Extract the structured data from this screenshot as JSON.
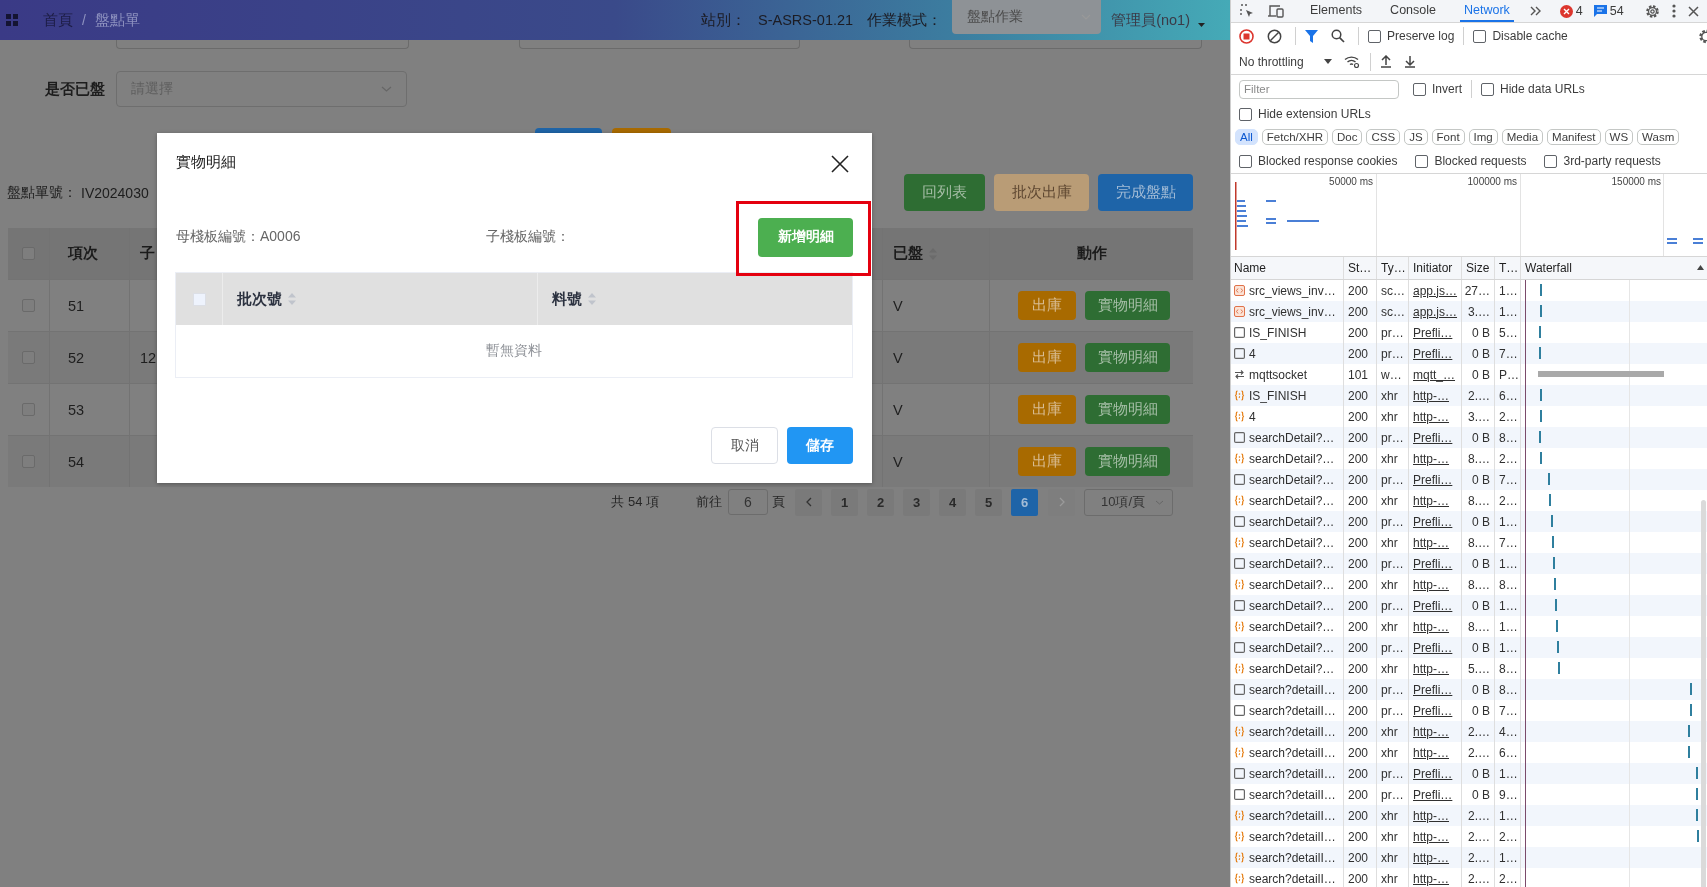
{
  "header": {
    "breadcrumb": [
      {
        "label": "首頁",
        "current": false
      },
      {
        "label": "盤點單",
        "current": true
      }
    ],
    "separator": "/",
    "station_label": "站別：",
    "station": "S-ASRS-01.21",
    "mode_label": "作業模式：",
    "mode": "盤點作業",
    "user": "管理員(no1)"
  },
  "filter": {
    "label": "是否已盤",
    "placeholder": "請選擇"
  },
  "order": {
    "label": "盤點單號：",
    "value": "IV2024030"
  },
  "actions": [
    {
      "label": "回列表",
      "kind": "success",
      "disabled": false
    },
    {
      "label": "批次出庫",
      "kind": "warning",
      "disabled": true
    },
    {
      "label": "完成盤點",
      "kind": "primary",
      "disabled": false
    }
  ],
  "table": {
    "select_all_checked": false,
    "columns": [
      {
        "label": "項次",
        "sortable": false
      },
      {
        "label": "子",
        "sortable": false
      },
      {
        "label": "已盤",
        "sortable": true
      },
      {
        "label": "動作",
        "sortable": false
      }
    ],
    "rows": [
      {
        "checked": false,
        "item": "51",
        "counted": "V",
        "buttons": [
          {
            "label": "出庫",
            "kind": "warning"
          },
          {
            "label": "實物明細",
            "kind": "success"
          }
        ]
      },
      {
        "checked": false,
        "item": "52",
        "column_3": "12",
        "counted": "V",
        "buttons": [
          {
            "label": "出庫",
            "kind": "warning"
          },
          {
            "label": "實物明細",
            "kind": "success"
          }
        ]
      },
      {
        "checked": false,
        "item": "53",
        "counted": "V",
        "buttons": [
          {
            "label": "出庫",
            "kind": "warning"
          },
          {
            "label": "實物明細",
            "kind": "success"
          }
        ]
      },
      {
        "checked": false,
        "item": "54",
        "counted": "V",
        "buttons": [
          {
            "label": "出庫",
            "kind": "warning"
          },
          {
            "label": "實物明細",
            "kind": "success"
          }
        ]
      }
    ]
  },
  "pagination": {
    "total": "共 54 項",
    "goto": "前往",
    "goto_value": "6",
    "page_suffix": "頁",
    "pages": [
      {
        "label": "1",
        "selected": false
      },
      {
        "label": "2",
        "selected": false
      },
      {
        "label": "3",
        "selected": false
      },
      {
        "label": "4",
        "selected": false
      },
      {
        "label": "5",
        "selected": false
      },
      {
        "label": "6",
        "selected": true
      }
    ],
    "next_disabled": true,
    "page_size": "10項/頁"
  },
  "dialog": {
    "title": "實物明細",
    "parent_label": "母棧板編號：",
    "parent_value": "A0006",
    "child_label": "子棧板編號：",
    "add_button": {
      "label": "新增明細",
      "highlighted": true
    },
    "table": {
      "select_all_checked": false,
      "columns": [
        {
          "label": "批次號",
          "sortable": true
        },
        {
          "label": "料號",
          "sortable": true
        }
      ],
      "empty_text": "暫無資料"
    },
    "buttons": [
      {
        "label": "取消",
        "kind": "default"
      },
      {
        "label": "儲存",
        "kind": "primary"
      }
    ]
  },
  "devtools": {
    "tabs": [
      {
        "label": "Elements",
        "selected": false
      },
      {
        "label": "Console",
        "selected": false
      },
      {
        "label": "Network",
        "selected": true
      }
    ],
    "errors": "4",
    "messages": "54",
    "toolbar_checks": [
      {
        "label": "Preserve log",
        "checked": false
      },
      {
        "label": "Disable cache",
        "checked": false
      }
    ],
    "throttling": "No throttling",
    "filter_placeholder": "Filter",
    "filter_checks": [
      {
        "label": "Invert",
        "checked": false
      },
      {
        "label": "Hide data URLs",
        "checked": false
      }
    ],
    "extension_check": {
      "label": "Hide extension URLs",
      "checked": false
    },
    "type_filters": [
      {
        "label": "All",
        "selected": true
      },
      {
        "label": "Fetch/XHR",
        "selected": false
      },
      {
        "label": "Doc",
        "selected": false
      },
      {
        "label": "CSS",
        "selected": false
      },
      {
        "label": "JS",
        "selected": false
      },
      {
        "label": "Font",
        "selected": false
      },
      {
        "label": "Img",
        "selected": false
      },
      {
        "label": "Media",
        "selected": false
      },
      {
        "label": "Manifest",
        "selected": false
      },
      {
        "label": "WS",
        "selected": false
      },
      {
        "label": "Wasm",
        "selected": false
      }
    ],
    "blocked_checks": [
      {
        "label": "Blocked response cookies",
        "checked": false
      },
      {
        "label": "Blocked requests",
        "checked": false
      },
      {
        "label": "3rd-party requests",
        "checked": false
      }
    ],
    "overview_ticks": [
      "50000 ms",
      "100000 ms",
      "150000 ms"
    ],
    "columns": [
      "Name",
      "St…",
      "Ty…",
      "Initiator",
      "Size",
      "T…",
      "Waterfall"
    ],
    "requests": [
      {
        "kind": "script",
        "name": "src_views_inv…",
        "status": "200",
        "type": "sc…",
        "initiator": "app.js…",
        "size": "27…",
        "time": "1…"
      },
      {
        "kind": "script",
        "name": "src_views_inv…",
        "status": "200",
        "type": "sc…",
        "initiator": "app.js…",
        "size": "3.…",
        "time": "1…"
      },
      {
        "kind": "preflight",
        "name": "IS_FINISH",
        "status": "200",
        "type": "pr…",
        "initiator": "Prefli…",
        "size": "0 B",
        "time": "5…"
      },
      {
        "kind": "preflight",
        "name": "4",
        "status": "200",
        "type": "pr…",
        "initiator": "Prefli…",
        "size": "0 B",
        "time": "7…"
      },
      {
        "kind": "websocket",
        "name": "mqttsocket",
        "status": "101",
        "type": "w…",
        "initiator": "mqtt_…",
        "size": "0 B",
        "time": "P…"
      },
      {
        "kind": "xhr",
        "name": "IS_FINISH",
        "status": "200",
        "type": "xhr",
        "initiator": "http-…",
        "size": "2.…",
        "time": "6…"
      },
      {
        "kind": "xhr",
        "name": "4",
        "status": "200",
        "type": "xhr",
        "initiator": "http-…",
        "size": "3.…",
        "time": "2…"
      },
      {
        "kind": "preflight",
        "name": "searchDetail?…",
        "status": "200",
        "type": "pr…",
        "initiator": "Prefli…",
        "size": "0 B",
        "time": "8…"
      },
      {
        "kind": "xhr",
        "name": "searchDetail?…",
        "status": "200",
        "type": "xhr",
        "initiator": "http-…",
        "size": "8.…",
        "time": "2…"
      },
      {
        "kind": "preflight",
        "name": "searchDetail?…",
        "status": "200",
        "type": "pr…",
        "initiator": "Prefli…",
        "size": "0 B",
        "time": "7…"
      },
      {
        "kind": "xhr",
        "name": "searchDetail?…",
        "status": "200",
        "type": "xhr",
        "initiator": "http-…",
        "size": "8.…",
        "time": "2…"
      },
      {
        "kind": "preflight",
        "name": "searchDetail?…",
        "status": "200",
        "type": "pr…",
        "initiator": "Prefli…",
        "size": "0 B",
        "time": "1…"
      },
      {
        "kind": "xhr",
        "name": "searchDetail?…",
        "status": "200",
        "type": "xhr",
        "initiator": "http-…",
        "size": "8.…",
        "time": "7…"
      },
      {
        "kind": "preflight",
        "name": "searchDetail?…",
        "status": "200",
        "type": "pr…",
        "initiator": "Prefli…",
        "size": "0 B",
        "time": "1…"
      },
      {
        "kind": "xhr",
        "name": "searchDetail?…",
        "status": "200",
        "type": "xhr",
        "initiator": "http-…",
        "size": "8.…",
        "time": "8…"
      },
      {
        "kind": "preflight",
        "name": "searchDetail?…",
        "status": "200",
        "type": "pr…",
        "initiator": "Prefli…",
        "size": "0 B",
        "time": "1…"
      },
      {
        "kind": "xhr",
        "name": "searchDetail?…",
        "status": "200",
        "type": "xhr",
        "initiator": "http-…",
        "size": "8.…",
        "time": "1…"
      },
      {
        "kind": "preflight",
        "name": "searchDetail?…",
        "status": "200",
        "type": "pr…",
        "initiator": "Prefli…",
        "size": "0 B",
        "time": "1…"
      },
      {
        "kind": "xhr",
        "name": "searchDetail?…",
        "status": "200",
        "type": "xhr",
        "initiator": "http-…",
        "size": "5.…",
        "time": "8…"
      },
      {
        "kind": "preflight",
        "name": "search?detailI…",
        "status": "200",
        "type": "pr…",
        "initiator": "Prefli…",
        "size": "0 B",
        "time": "8…"
      },
      {
        "kind": "preflight",
        "name": "search?detailI…",
        "status": "200",
        "type": "pr…",
        "initiator": "Prefli…",
        "size": "0 B",
        "time": "7…"
      },
      {
        "kind": "xhr",
        "name": "search?detailI…",
        "status": "200",
        "type": "xhr",
        "initiator": "http-…",
        "size": "2.…",
        "time": "4…"
      },
      {
        "kind": "xhr",
        "name": "search?detailI…",
        "status": "200",
        "type": "xhr",
        "initiator": "http-…",
        "size": "2.…",
        "time": "6…"
      },
      {
        "kind": "preflight",
        "name": "search?detailI…",
        "status": "200",
        "type": "pr…",
        "initiator": "Prefli…",
        "size": "0 B",
        "time": "1…"
      },
      {
        "kind": "preflight",
        "name": "search?detailI…",
        "status": "200",
        "type": "pr…",
        "initiator": "Prefli…",
        "size": "0 B",
        "time": "9…"
      },
      {
        "kind": "xhr",
        "name": "search?detailI…",
        "status": "200",
        "type": "xhr",
        "initiator": "http-…",
        "size": "2.…",
        "time": "1…"
      },
      {
        "kind": "xhr",
        "name": "search?detailI…",
        "status": "200",
        "type": "xhr",
        "initiator": "http-…",
        "size": "2.…",
        "time": "2…"
      },
      {
        "kind": "xhr",
        "name": "search?detailI…",
        "status": "200",
        "type": "xhr",
        "initiator": "http-…",
        "size": "2.…",
        "time": "1…"
      },
      {
        "kind": "xhr",
        "name": "search?detailI…",
        "status": "200",
        "type": "xhr",
        "initiator": "http-…",
        "size": "2.…",
        "time": "2…"
      }
    ]
  }
}
